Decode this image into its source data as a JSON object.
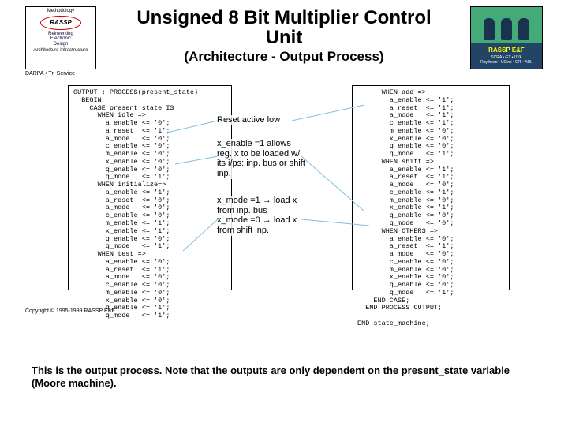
{
  "title_line1": "Unsigned 8 Bit Multiplier Control",
  "title_line2": "Unit",
  "subtitle": "(Architecture - Output Process)",
  "logo_left": {
    "top": "Methodology",
    "brand": "RASSP",
    "sub": "Reinventing\nElectronic\nDesign",
    "tag": "Architecture  Infrastructure"
  },
  "logo_right": {
    "brand": "RASSP E&F",
    "tag": "SCRA • GT • UVA\nRaytheon • UCinc • EIT • ADL"
  },
  "darpa": "DARPA • Tri-Service",
  "code_left": "OUTPUT : PROCESS(present_state)\n  BEGIN\n    CASE present_state IS\n      WHEN idle =>\n        a_enable <= '0';\n        a_reset  <= '1';\n        a_mode   <= '0';\n        c_enable <= '0';\n        m_enable <= '0';\n        x_enable <= '0';\n        q_enable <= '0';\n        q_mode   <= '1';\n      WHEN initialize=>\n        a_enable <= '1';\n        a_reset  <= '0';\n        a_mode   <= '0';\n        c_enable <= '0';\n        m_enable <= '1';\n        x_enable <= '1';\n        q_enable <= '0';\n        q_mode   <= '1';\n      WHEN test =>\n        a_enable <= '0';\n        a_reset  <= '1';\n        a_mode   <= '0';\n        c_enable <= '0';\n        m_enable <= '0';\n        x_enable <= '0';\n        q_enable <= '1';\n        q_mode   <= '1';",
  "code_right": "      WHEN add =>\n        a_enable <= '1';\n        a_reset  <= '1';\n        a_mode   <= '1';\n        c_enable <= '1';\n        m_enable <= '0';\n        x_enable <= '0';\n        q_enable <= '0';\n        q_mode   <= '1';\n      WHEN shift =>\n        a_enable <= '1';\n        a_reset  <= '1';\n        a_mode   <= '0';\n        c_enable <= '1';\n        m_enable <= '0';\n        x_enable <= '1';\n        q_enable <= '0';\n        q_mode   <= '0';\n      WHEN OTHERS =>\n        a_enable <= '0';\n        a_reset  <= '1';\n        a_mode   <= '0';\n        c_enable <= '0';\n        m_enable <= '0';\n        x_enable <= '0';\n        q_enable <= '0';\n        q_mode   <= '1';\n    END CASE;\n  END PROCESS OUTPUT;\n\nEND state_machine;",
  "annot1": "Reset active low",
  "annot2": "x_enable =1 allows reg. x to be loaded w/ its i/ps: inp. bus or shift inp.",
  "annot3": "x_mode =1 → load x from inp. bus\nx_mode =0 → load x from shift inp.",
  "copyright": "Copyright © 1995-1999 RASSP E&F",
  "caption": "This is the output process. Note that the outputs are only dependent on the present_state variable (Moore machine)."
}
